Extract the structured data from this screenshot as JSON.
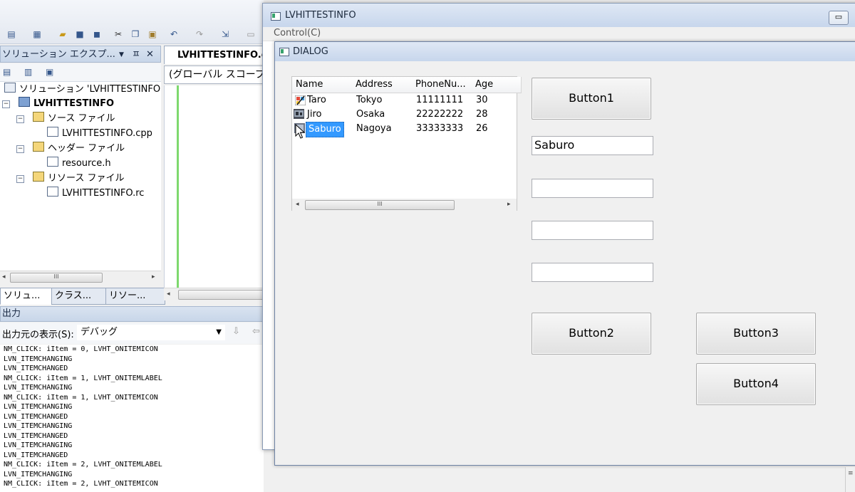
{
  "ide": {
    "solution_explorer": {
      "title": "ソリューション エクスプ...",
      "pin": "ㅍ",
      "close": "✕",
      "tree": {
        "solution": "ソリューション 'LVHITTESTINFO",
        "project": "LVHITTESTINFO",
        "source_folder": "ソース ファイル",
        "source_file": "LVHITTESTINFO.cpp",
        "header_folder": "ヘッダー ファイル",
        "header_file": "resource.h",
        "resource_folder": "リソース ファイル",
        "resource_file": "LVHITTESTINFO.rc"
      },
      "tabs": [
        "ソリュ...",
        "クラス...",
        "リソー..."
      ]
    },
    "editor": {
      "tab": "LVHITTESTINFO.c",
      "scope": "(グローバル スコープ)"
    },
    "output": {
      "title": "出力",
      "source_label": "出力元の表示(S):",
      "source_value": "デバッグ",
      "lines": [
        "NM_CLICK: iItem = 0, LVHT_ONITEMICON",
        "LVN_ITEMCHANGING",
        "LVN_ITEMCHANGED",
        "NM_CLICK: iItem = 1, LVHT_ONITEMLABEL",
        "LVN_ITEMCHANGING",
        "NM_CLICK: iItem = 1, LVHT_ONITEMICON",
        "LVN_ITEMCHANGING",
        "LVN_ITEMCHANGED",
        "LVN_ITEMCHANGING",
        "LVN_ITEMCHANGED",
        "LVN_ITEMCHANGING",
        "LVN_ITEMCHANGED",
        "NM_CLICK: iItem = 2, LVHT_ONITEMLABEL",
        "LVN_ITEMCHANGING",
        "NM_CLICK: iItem = 2, LVHT_ONITEMICON"
      ]
    }
  },
  "app_window": {
    "title": "LVHITTESTINFO",
    "menu": "Control(C)",
    "minimize": "▭"
  },
  "dialog": {
    "title": "DIALOG",
    "listview": {
      "columns": [
        "Name",
        "Address",
        "PhoneNu...",
        "Age"
      ],
      "rows": [
        {
          "name": "Taro",
          "address": "Tokyo",
          "phone": "11111111",
          "age": "30"
        },
        {
          "name": "Jiro",
          "address": "Osaka",
          "phone": "22222222",
          "age": "28"
        },
        {
          "name": "Saburo",
          "address": "Nagoya",
          "phone": "33333333",
          "age": "26"
        }
      ],
      "selected_row": 2,
      "scroll_mark": "III"
    },
    "buttons": {
      "button1": "Button1",
      "button2": "Button2",
      "button3": "Button3",
      "button4": "Button4"
    },
    "edits": [
      "Saburo",
      "",
      "",
      ""
    ]
  },
  "colors": {
    "selection": "#3399ff",
    "titlebar": "#c7d6ec",
    "editor_margin_green": "#7ed96e"
  }
}
